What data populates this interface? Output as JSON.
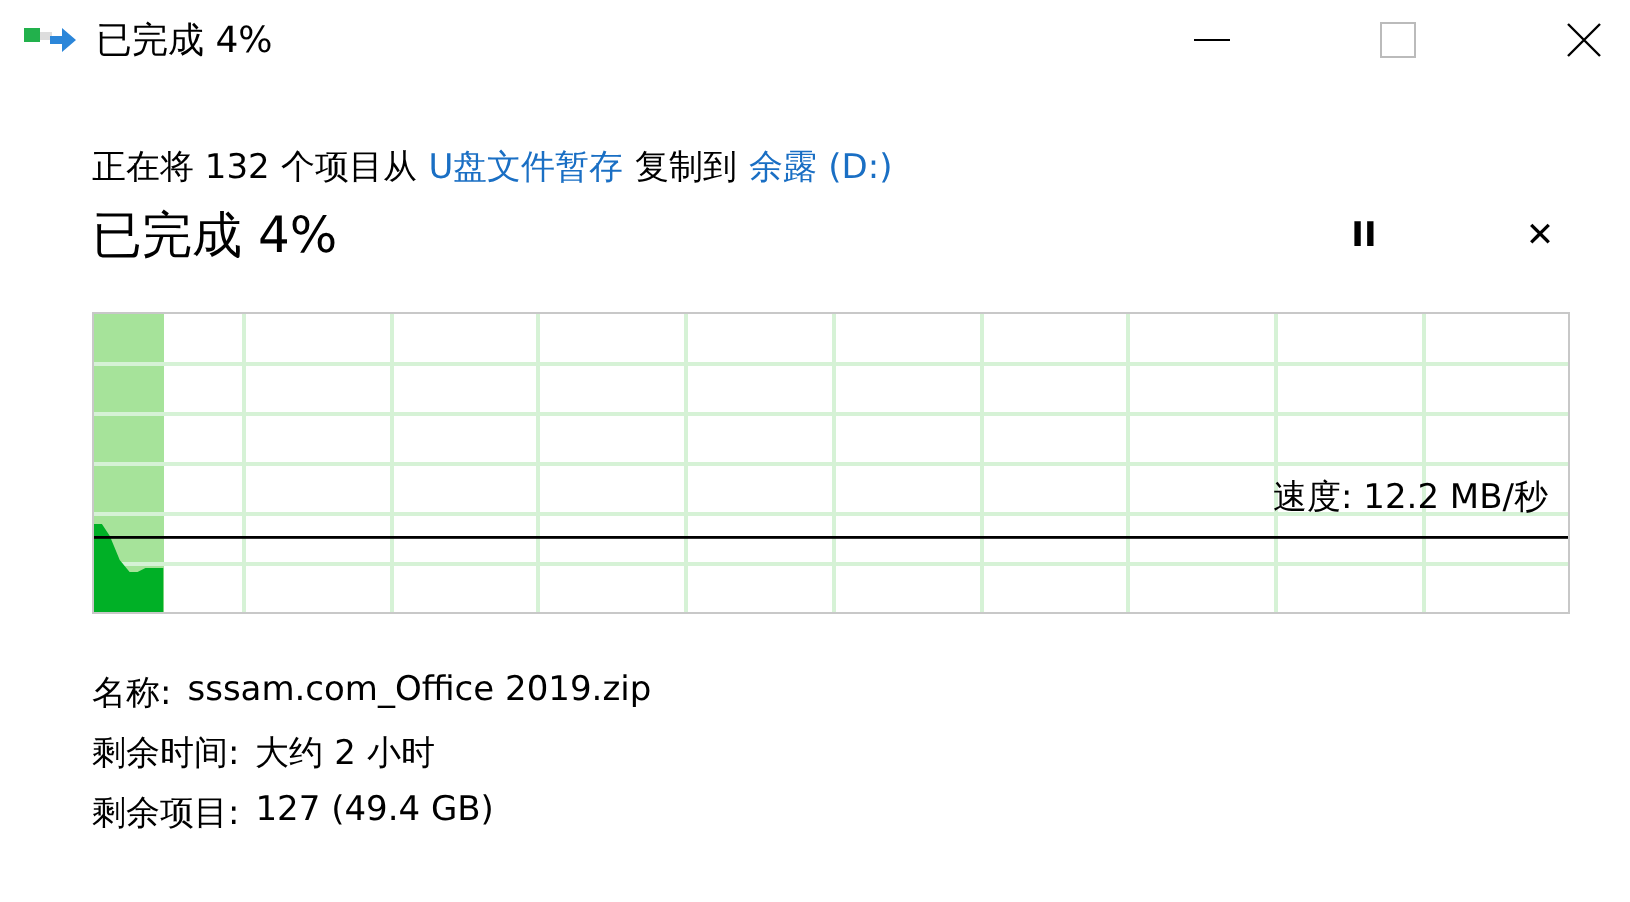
{
  "window": {
    "title": "已完成 4%"
  },
  "description": {
    "prefix": "正在将 132 个项目从",
    "source": "U盘文件暂存",
    "middle": "复制到",
    "destination": "余露 (D:)"
  },
  "heading": "已完成 4%",
  "actions": {
    "pause": "II",
    "cancel": "✕"
  },
  "progress": {
    "level": 0.047,
    "speed": "速度: 12.2 MB/秒"
  },
  "details": [
    {
      "label": "名称:",
      "value": "sssam.com_Office 2019.zip"
    },
    {
      "label": "剩余时间:",
      "value": "大约 2 小时"
    },
    {
      "label": "剩余项目:",
      "value": "127 (49.4 GB)"
    }
  ]
}
